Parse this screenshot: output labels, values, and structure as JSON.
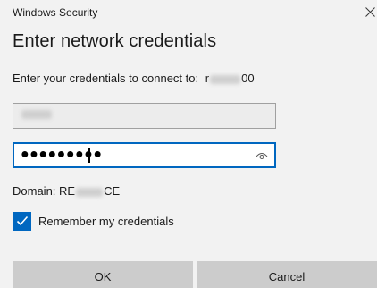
{
  "window": {
    "app_title": "Windows Security"
  },
  "dialog": {
    "heading": "Enter network credentials",
    "prompt": "Enter your credentials to connect to:",
    "host_visible_prefix": "r",
    "host_visible_suffix": "00",
    "username": {
      "value_redacted": true
    },
    "password": {
      "masked_value": "●●●●●●●●●",
      "reveal_icon": "eye-icon"
    },
    "domain_label": "Domain: RE",
    "domain_suffix": "CE",
    "remember": {
      "label": "Remember my credentials",
      "checked": true
    }
  },
  "buttons": {
    "ok_label": "OK",
    "cancel_label": "Cancel"
  },
  "colors": {
    "accent": "#0067c0",
    "background": "#f2f2f2",
    "button": "#cccccc"
  }
}
